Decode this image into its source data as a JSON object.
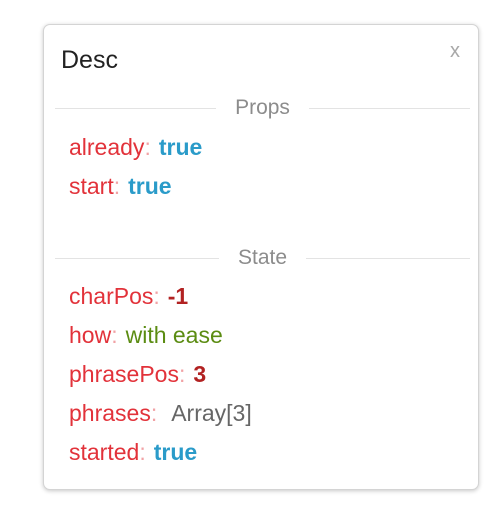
{
  "panel": {
    "title": "Desc",
    "close_label": "x"
  },
  "props": {
    "heading": "Props",
    "items": [
      {
        "key": "already",
        "value": "true",
        "type": "bool"
      },
      {
        "key": "start",
        "value": "true",
        "type": "bool"
      }
    ]
  },
  "state": {
    "heading": "State",
    "items": [
      {
        "key": "charPos",
        "value": "-1",
        "type": "number"
      },
      {
        "key": "how",
        "value": "with ease",
        "type": "string"
      },
      {
        "key": "phrasePos",
        "value": "3",
        "type": "number"
      },
      {
        "key": "phrases",
        "value": "Array[3]",
        "type": "object"
      },
      {
        "key": "started",
        "value": "true",
        "type": "bool"
      }
    ]
  },
  "colors": {
    "key": "#e2323a",
    "bool": "#2a9bc9",
    "number": "#b22222",
    "string": "#5b8c12",
    "object": "#666666"
  }
}
